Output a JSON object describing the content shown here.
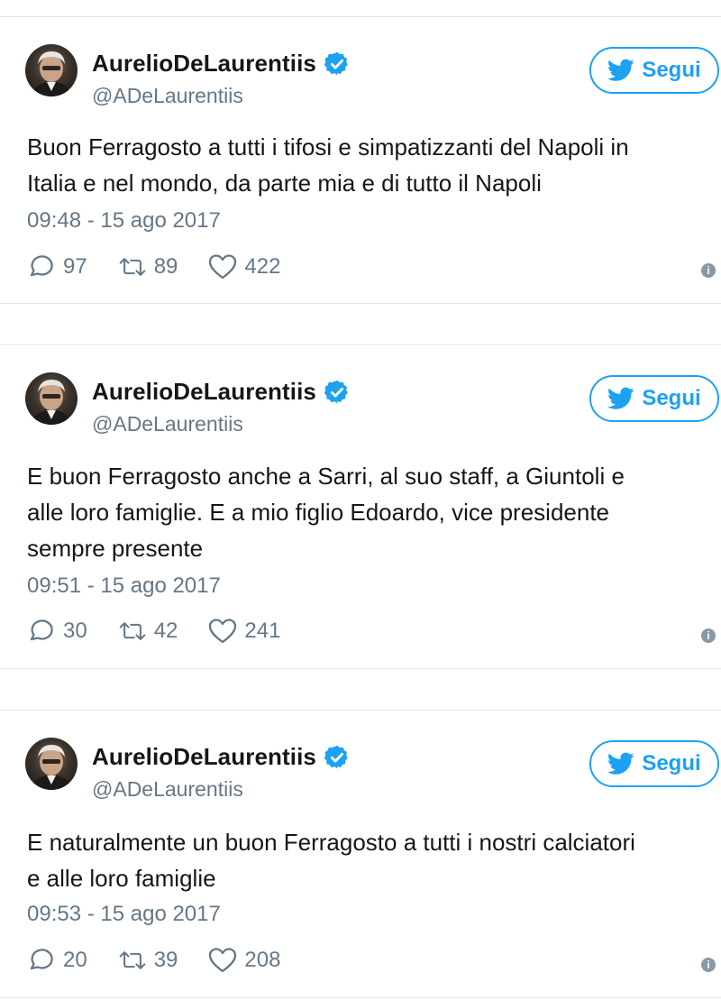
{
  "tweets": [
    {
      "author_name": "AurelioDeLaurentiis",
      "handle": "@ADeLaurentiis",
      "follow_label": "Segui",
      "text_lines": [
        "Buon Ferragosto a tutti i tifosi e simpatizzanti del Napoli in",
        "Italia e nel mondo, da parte mia e di tutto il Napoli"
      ],
      "timestamp": "09:48 - 15 ago 2017",
      "replies": "97",
      "retweets": "89",
      "likes": "422"
    },
    {
      "author_name": "AurelioDeLaurentiis",
      "handle": "@ADeLaurentiis",
      "follow_label": "Segui",
      "text_lines": [
        "E buon Ferragosto anche a Sarri, al suo staff, a Giuntoli e",
        "alle loro famiglie. E a mio figlio Edoardo, vice presidente",
        "sempre presente"
      ],
      "timestamp": "09:51 - 15 ago 2017",
      "replies": "30",
      "retweets": "42",
      "likes": "241"
    },
    {
      "author_name": "AurelioDeLaurentiis",
      "handle": "@ADeLaurentiis",
      "follow_label": "Segui",
      "text_lines": [
        "E naturalmente un buon Ferragosto a tutti i nostri calciatori",
        "e alle loro famiglie"
      ],
      "timestamp": "09:53 - 15 ago 2017",
      "replies": "20",
      "retweets": "39",
      "likes": "208"
    }
  ],
  "icons": {
    "verified": "verified-badge-icon",
    "bird": "twitter-bird-icon",
    "reply": "reply-icon",
    "retweet": "retweet-icon",
    "like": "heart-icon",
    "info": "info-icon"
  },
  "colors": {
    "accent": "#1da1f2",
    "muted": "#657786",
    "border": "#e1e8ed"
  }
}
